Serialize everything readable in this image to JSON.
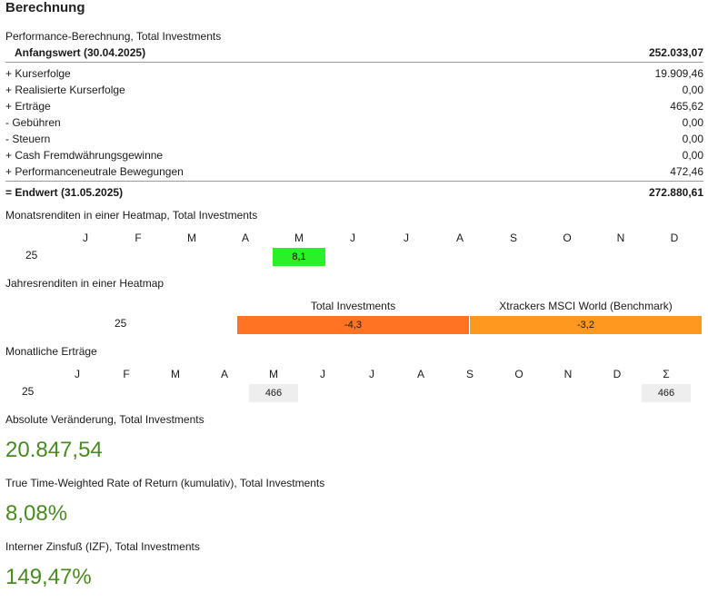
{
  "title": "Berechnung",
  "performance": {
    "heading": "Performance-Berechnung, Total Investments",
    "start_label": "Anfangswert (30.04.2025)",
    "start_value": "252.033,07",
    "rows": [
      {
        "label": "+ Kurserfolge",
        "value": "19.909,46"
      },
      {
        "label": "+ Realisierte Kurserfolge",
        "value": "0,00"
      },
      {
        "label": "+ Erträge",
        "value": "465,62"
      },
      {
        "label": "-  Gebühren",
        "value": "0,00"
      },
      {
        "label": "-  Steuern",
        "value": "0,00"
      },
      {
        "label": "+ Cash Fremdwährungsgewinne",
        "value": "0,00"
      },
      {
        "label": "+ Performanceneutrale Bewegungen",
        "value": "472,46"
      }
    ],
    "end_label": "= Endwert (31.05.2025)",
    "end_value": "272.880,61"
  },
  "monthly_heatmap": {
    "heading": "Monatsrenditen in einer Heatmap, Total Investments",
    "months": [
      "J",
      "F",
      "M",
      "A",
      "M",
      "J",
      "J",
      "A",
      "S",
      "O",
      "N",
      "D"
    ],
    "year": "25",
    "value": "8,1",
    "color": "#2af02a"
  },
  "yearly_heatmap": {
    "heading": "Jahresrenditen in einer Heatmap",
    "col1": "Total Investments",
    "col2": "Xtrackers MSCI World (Benchmark)",
    "year": "25",
    "value1": "-4,3",
    "value2": "-3,2",
    "color1": "#ff7322",
    "color2": "#ff981e"
  },
  "monthly_income": {
    "heading": "Monatliche Erträge",
    "months": [
      "J",
      "F",
      "M",
      "A",
      "M",
      "J",
      "J",
      "A",
      "S",
      "O",
      "N",
      "D",
      "Σ"
    ],
    "year": "25",
    "may_value": "466",
    "sum_value": "466"
  },
  "absolute_change": {
    "heading": "Absolute Veränderung, Total Investments",
    "value": "20.847,54"
  },
  "ttwror": {
    "heading": "True Time-Weighted Rate of Return (kumulativ), Total Investments",
    "value": "8,08%"
  },
  "irr": {
    "heading": "Interner Zinsfuß (IZF), Total Investments",
    "value": "149,47%"
  },
  "accent_color": "#4a8a22"
}
